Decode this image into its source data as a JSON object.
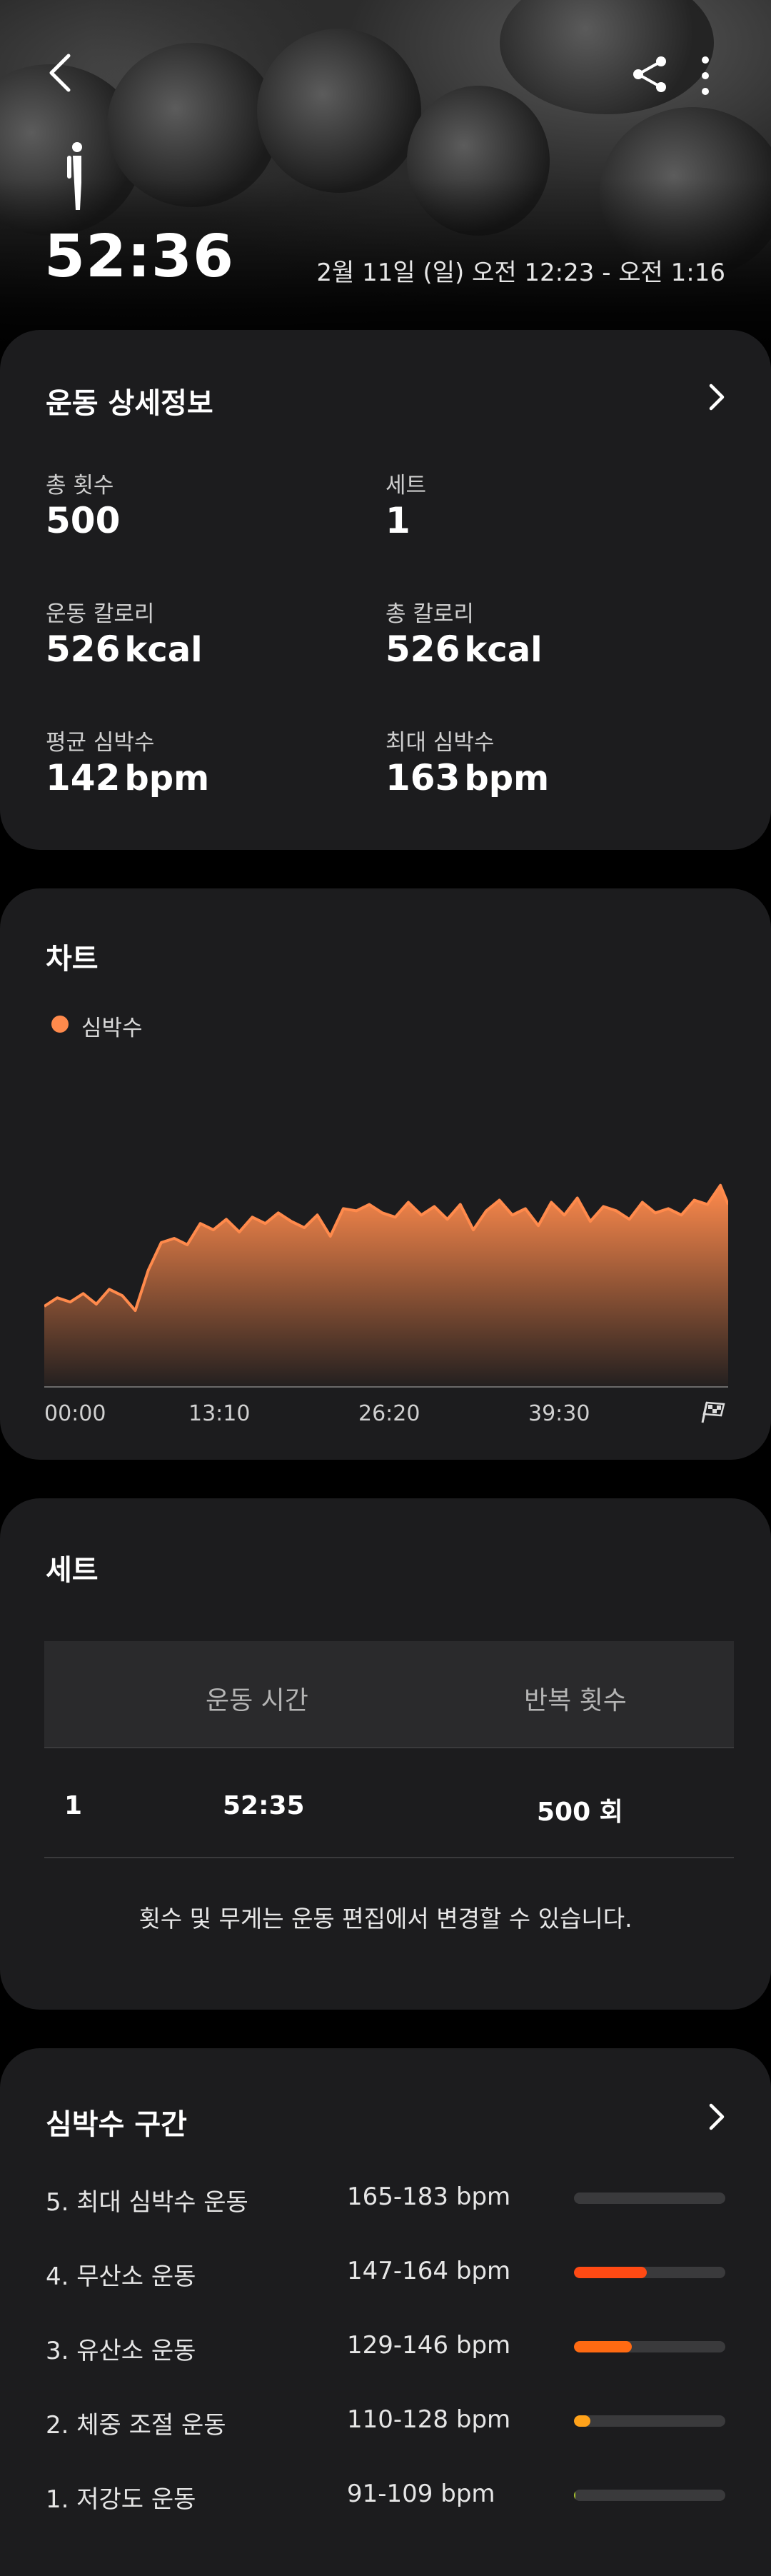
{
  "header": {
    "duration": "52:36",
    "date_range": "2월 11일 (일) 오전 12:23 - 오전 1:16"
  },
  "details": {
    "title": "운동 상세정보",
    "stats": [
      {
        "label": "총 횟수",
        "value": "500",
        "unit": ""
      },
      {
        "label": "세트",
        "value": "1",
        "unit": ""
      },
      {
        "label": "운동 칼로리",
        "value": "526",
        "unit": "kcal"
      },
      {
        "label": "총 칼로리",
        "value": "526",
        "unit": "kcal"
      },
      {
        "label": "평균 심박수",
        "value": "142",
        "unit": "bpm"
      },
      {
        "label": "최대 심박수",
        "value": "163",
        "unit": "bpm"
      }
    ]
  },
  "chart": {
    "title": "차트",
    "legend": "심박수",
    "color": "#ff8a4c"
  },
  "chart_data": {
    "type": "area",
    "title": "차트",
    "series": [
      {
        "name": "심박수",
        "x_minutes": [
          0,
          1,
          2,
          3,
          4,
          5,
          6,
          7,
          8,
          9,
          10,
          11,
          12,
          13,
          14,
          15,
          16,
          17,
          18,
          19,
          20,
          21,
          22,
          23,
          24,
          25,
          26,
          27,
          28,
          29,
          30,
          31,
          32,
          33,
          34,
          35,
          36,
          37,
          38,
          39,
          40,
          41,
          42,
          43,
          44,
          45,
          46,
          47,
          48,
          49,
          50,
          51,
          52,
          52.6
        ],
        "values": [
          98,
          102,
          100,
          104,
          99,
          106,
          103,
          96,
          115,
          128,
          130,
          127,
          137,
          134,
          139,
          133,
          140,
          137,
          142,
          138,
          135,
          141,
          131,
          144,
          143,
          146,
          142,
          140,
          147,
          141,
          145,
          139,
          146,
          134,
          143,
          148,
          141,
          144,
          136,
          147,
          141,
          149,
          138,
          145,
          143,
          139,
          147,
          142,
          144,
          141,
          148,
          146,
          155,
          146
        ]
      }
    ],
    "x_ticks": [
      "00:00",
      "13:10",
      "26:20",
      "39:30"
    ],
    "ylim": [
      60,
      165
    ]
  },
  "sets": {
    "title": "세트",
    "columns": [
      "",
      "운동 시간",
      "반복 횟수"
    ],
    "rows": [
      {
        "set": "1",
        "time": "52:35",
        "reps": "500 회"
      }
    ],
    "note": "횟수 및 무게는 운동 편집에서 변경할 수 있습니다."
  },
  "zones": {
    "title": "심박수 구간",
    "items": [
      {
        "name": "5. 최대 심박수 운동",
        "range": "165-183 bpm",
        "fraction": 0.0,
        "color": "#ff3b1f"
      },
      {
        "name": "4. 무산소 운동",
        "range": "147-164 bpm",
        "fraction": 0.48,
        "color": "#ff4a14"
      },
      {
        "name": "3. 유산소 운동",
        "range": "129-146 bpm",
        "fraction": 0.38,
        "color": "#ff6a12"
      },
      {
        "name": "2. 체중 조절 운동",
        "range": "110-128 bpm",
        "fraction": 0.11,
        "color": "#ffa21a"
      },
      {
        "name": "1. 저강도 운동",
        "range": "91-109 bpm",
        "fraction": 0.01,
        "color": "#a6c22a"
      }
    ]
  }
}
